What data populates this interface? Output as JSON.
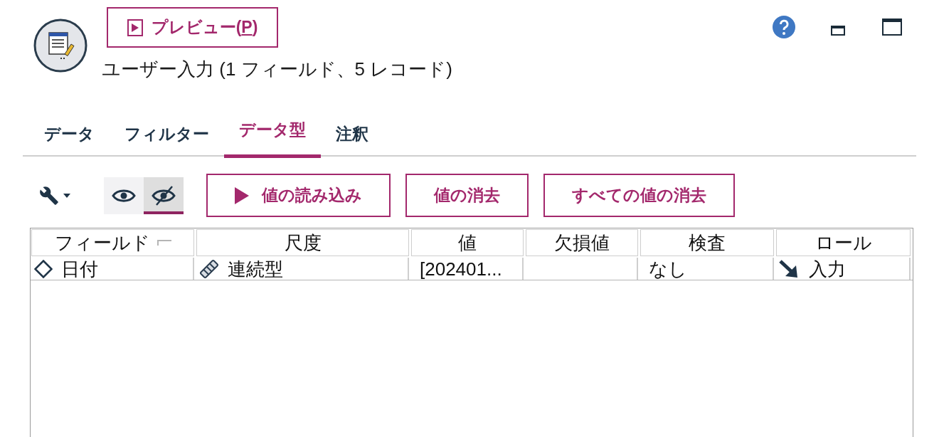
{
  "header": {
    "preview_button": {
      "label": "プレビュー(",
      "mnemonic": "P",
      "label_end": ")"
    },
    "title": "ユーザー入力 (1 フィールド、5 レコード)"
  },
  "tabs": [
    {
      "label": "データ",
      "selected": false
    },
    {
      "label": "フィルター",
      "selected": false
    },
    {
      "label": "データ型",
      "selected": true
    },
    {
      "label": "注釈",
      "selected": false
    }
  ],
  "toolbar": {
    "view_toggles": [
      {
        "kind": "show",
        "selected": false
      },
      {
        "kind": "hide",
        "selected": true
      }
    ],
    "buttons": [
      {
        "label": "値の読み込み",
        "kind": "play"
      },
      {
        "label": "値の消去",
        "kind": "plain"
      },
      {
        "label": "すべての値の消去",
        "kind": "plain"
      }
    ]
  },
  "table": {
    "columns": [
      {
        "label": "フィールド",
        "sort_marker": true
      },
      {
        "label": "尺度",
        "sort_marker": false
      },
      {
        "label": "値",
        "sort_marker": false
      },
      {
        "label": "欠損値",
        "sort_marker": false
      },
      {
        "label": "検査",
        "sort_marker": false
      },
      {
        "label": "ロール",
        "sort_marker": false
      }
    ],
    "rows": [
      {
        "cells": [
          {
            "kind": "date-field",
            "text": "日付"
          },
          {
            "kind": "continuous",
            "text": "連続型"
          },
          {
            "kind": "plain",
            "text": "[202401..."
          },
          {
            "kind": "plain"
          },
          {
            "kind": "plain",
            "text": "なし"
          },
          {
            "kind": "input-role",
            "text": "入力"
          }
        ]
      }
    ]
  }
}
